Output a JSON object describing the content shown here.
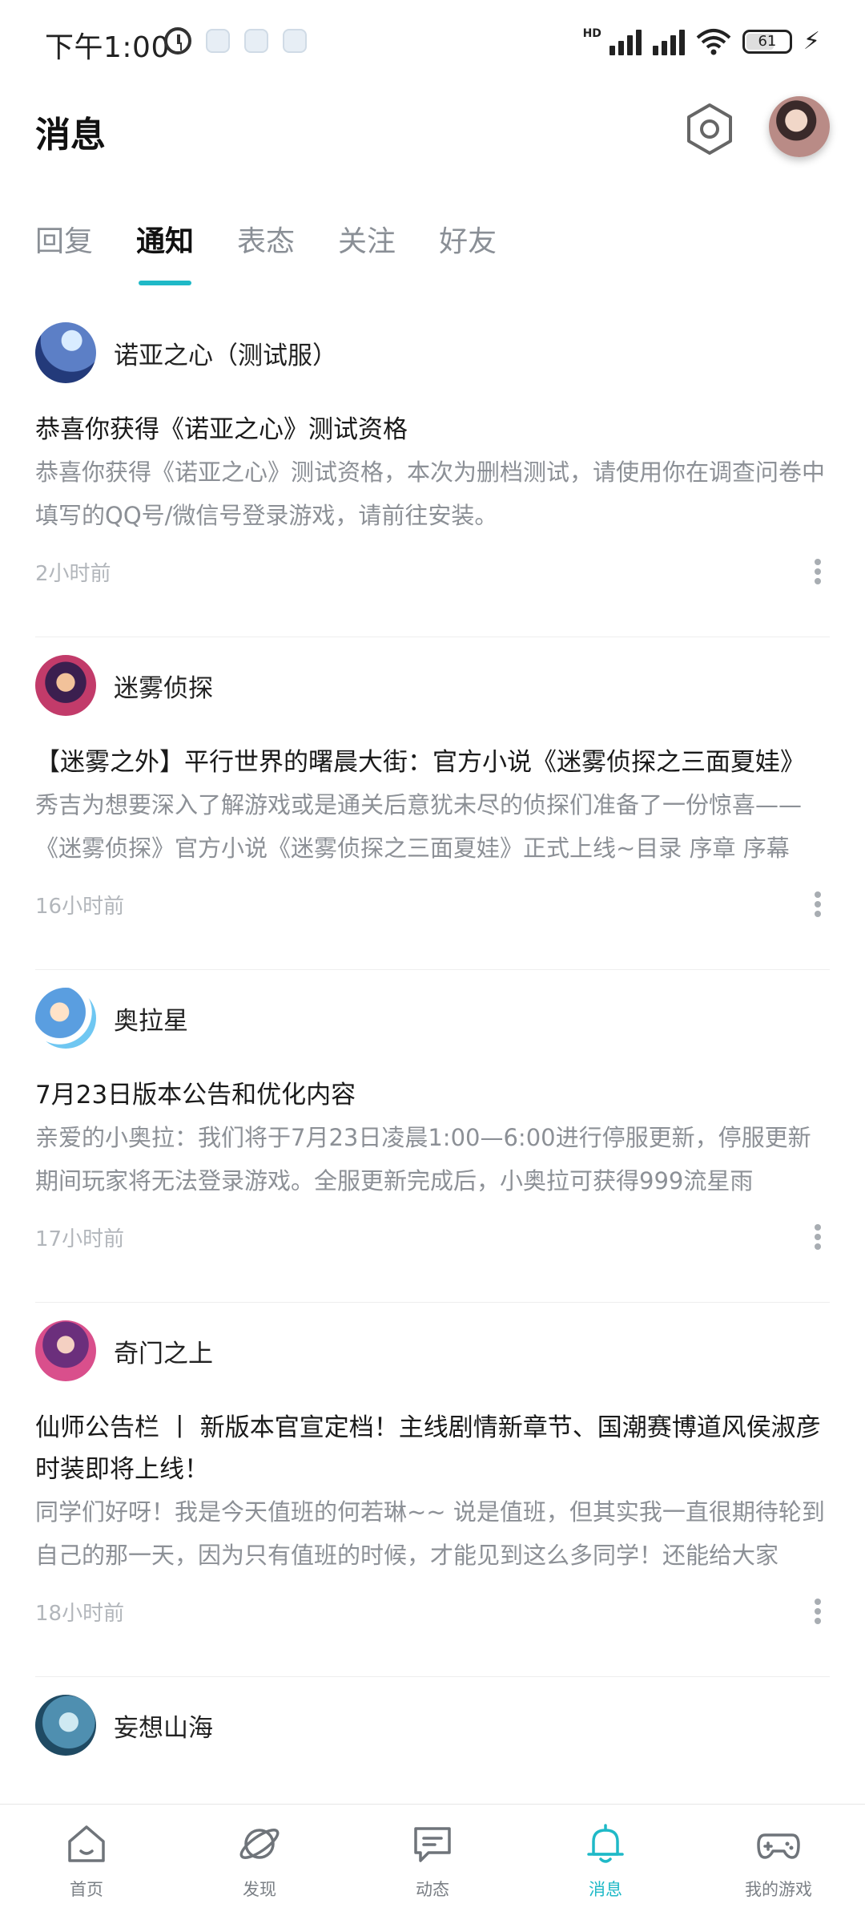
{
  "status_bar": {
    "time": "下午1:00",
    "network": "HD",
    "battery": "61"
  },
  "header": {
    "title": "消息"
  },
  "tabs": [
    {
      "label": "回复",
      "active": false
    },
    {
      "label": "通知",
      "active": true
    },
    {
      "label": "表态",
      "active": false
    },
    {
      "label": "关注",
      "active": false
    },
    {
      "label": "好友",
      "active": false
    }
  ],
  "notifications": [
    {
      "game": "诺亚之心（测试服）",
      "title": "恭喜你获得《诺亚之心》测试资格",
      "body": "恭喜你获得《诺亚之心》测试资格，本次为删档测试，请使用你在调查问卷中填写的QQ号/微信号登录游戏，请前往安装。",
      "time": "2小时前"
    },
    {
      "game": "迷雾侦探",
      "title": "【迷雾之外】平行世界的曙晨大街：官方小说《迷雾侦探之三面夏娃》",
      "body": "秀吉为想要深入了解游戏或是通关后意犹未尽的侦探们准备了一份惊喜——《迷雾侦探》官方小说《迷雾侦探之三面夏娃》正式上线~目录 序章 序幕",
      "time": "16小时前"
    },
    {
      "game": "奥拉星",
      "title": "7月23日版本公告和优化内容",
      "body": "亲爱的小奥拉：我们将于7月23日凌晨1:00—6:00进行停服更新，停服更新期间玩家将无法登录游戏。全服更新完成后，小奥拉可获得999流星雨",
      "time": "17小时前"
    },
    {
      "game": "奇门之上",
      "title": "仙师公告栏 丨 新版本官宣定档！主线剧情新章节、国潮赛博道风侯淑彦时装即将上线！",
      "body": "同学们好呀！我是今天值班的何若琳~~ 说是值班，但其实我一直很期待轮到自己的那一天，因为只有值班的时候，才能见到这么多同学！还能给大家",
      "time": "18小时前"
    },
    {
      "game": "妄想山海",
      "title": "",
      "body": "",
      "time": ""
    }
  ],
  "bottom_nav": [
    {
      "label": "首页",
      "icon": "home-icon",
      "active": false
    },
    {
      "label": "发现",
      "icon": "planet-icon",
      "active": false
    },
    {
      "label": "动态",
      "icon": "chat-bubble-icon",
      "active": false
    },
    {
      "label": "消息",
      "icon": "bell-icon",
      "active": true
    },
    {
      "label": "我的游戏",
      "icon": "gamepad-icon",
      "active": false
    }
  ],
  "colors": {
    "accent": "#1fb9c7",
    "muted_text": "#8c9096",
    "timestamp": "#b2b6bb"
  }
}
